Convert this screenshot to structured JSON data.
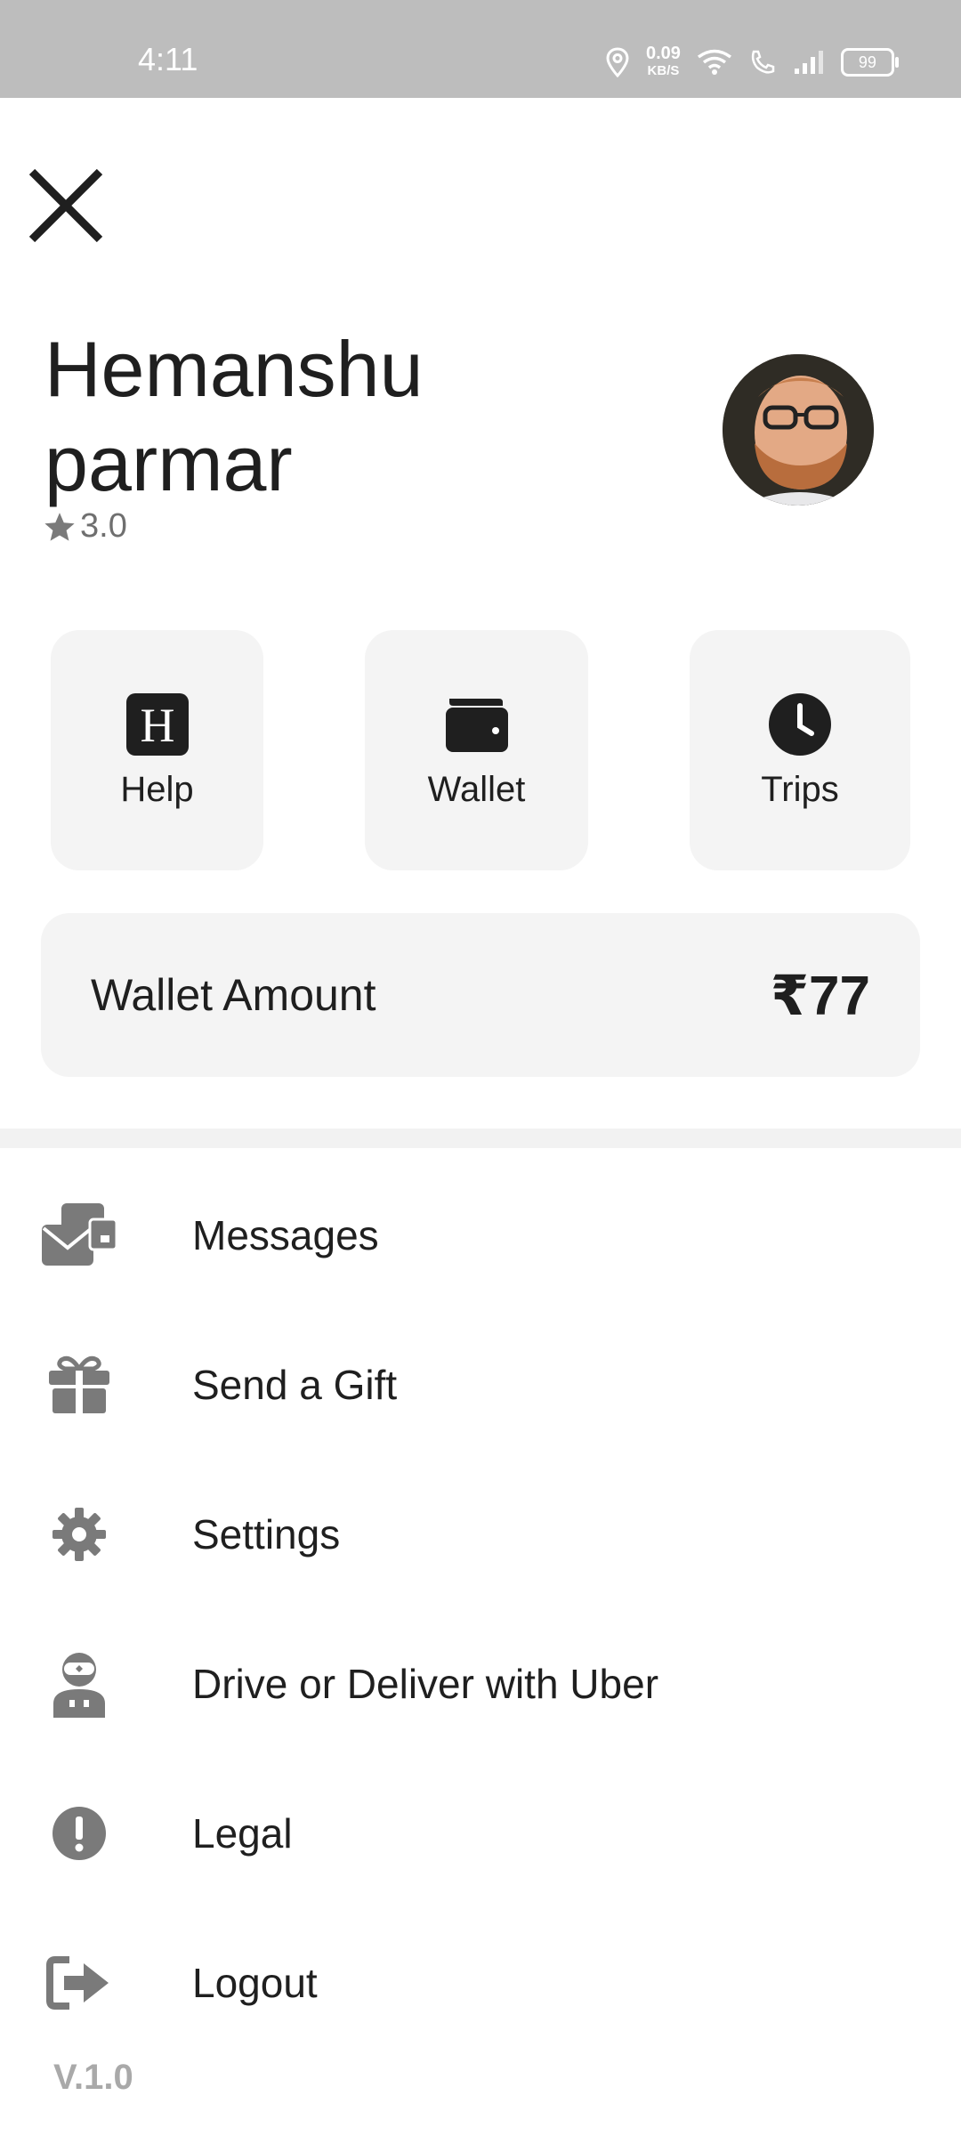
{
  "status_bar": {
    "time": "4:11",
    "net_speed": "0.09",
    "net_unit": "KB/S",
    "battery": "99"
  },
  "profile": {
    "name": "Hemanshu parmar",
    "rating": "3.0"
  },
  "quick_actions": [
    {
      "label": "Help",
      "icon": "help-icon"
    },
    {
      "label": "Wallet",
      "icon": "wallet-icon"
    },
    {
      "label": "Trips",
      "icon": "clock-icon"
    }
  ],
  "wallet": {
    "label": "Wallet Amount",
    "amount": "₹77"
  },
  "menu": [
    {
      "label": "Messages",
      "icon": "messages-icon"
    },
    {
      "label": "Send a Gift",
      "icon": "gift-icon"
    },
    {
      "label": "Settings",
      "icon": "gear-icon"
    },
    {
      "label": "Drive or Deliver with Uber",
      "icon": "driver-icon"
    },
    {
      "label": "Legal",
      "icon": "alert-icon"
    },
    {
      "label": "Logout",
      "icon": "logout-icon"
    }
  ],
  "version": "V.1.0",
  "colors": {
    "status_bar": "#bdbdbd",
    "card_bg": "#f4f4f4",
    "icon_grey": "#7a7a7a",
    "text": "#1f1f1f"
  }
}
